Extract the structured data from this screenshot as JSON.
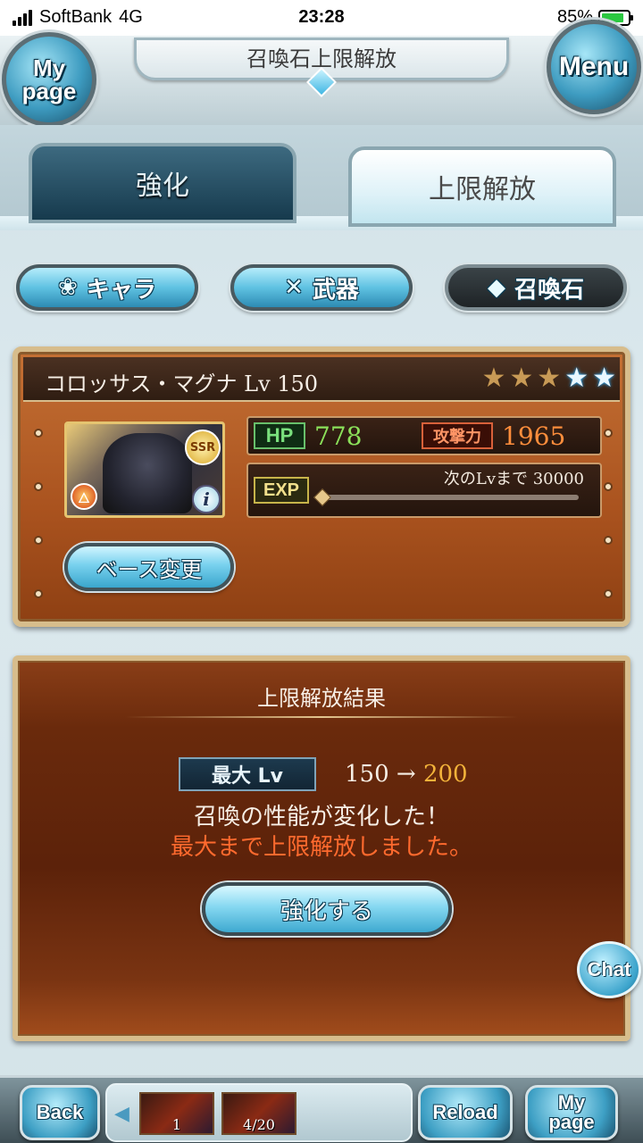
{
  "status_bar": {
    "carrier": "SoftBank",
    "network": "4G",
    "time": "23:28",
    "battery": "85%",
    "battery_level": 0.85
  },
  "header": {
    "title": "召喚石上限解放",
    "mypage_label": "My page",
    "menu_label": "Menu"
  },
  "tabs": [
    {
      "label": "強化",
      "active": false
    },
    {
      "label": "上限解放",
      "active": true
    }
  ],
  "categories": {
    "chara": "キャラ",
    "weapon": "武器",
    "summon": "召喚石",
    "selected": "召喚石"
  },
  "summon": {
    "name_level": "コロッサス・マグナ Lv 150",
    "stars_total": 5,
    "stars_gold": 3,
    "stars_blue": 2,
    "rarity": "SSR",
    "element_icon": "fire-element-icon",
    "hp_label": "HP",
    "hp": "778",
    "atk_label": "攻撃力",
    "atk": "1965",
    "exp_label": "EXP",
    "exp_next": "次のLvまで 30000",
    "exp_progress": 0.0,
    "base_change_label": "ベース変更"
  },
  "result": {
    "title": "上限解放結果",
    "maxlv_label": "最大 Lv",
    "lv_from": "150",
    "arrow": "→",
    "lv_to": "200",
    "message1": "召喚の性能が変化した！",
    "message2": "最大まで上限解放しました。",
    "enhance_button": "強化する"
  },
  "chat_label": "Chat",
  "bottom_bar": {
    "back_label": "Back",
    "reload_label": "Reload",
    "mypage_label": "My page",
    "quest1_count": "1",
    "quest2_count": "4/20"
  },
  "colors": {
    "accent_blue": "#5fc2e2",
    "panel_brown": "#a9521e",
    "hp_green": "#8be05a",
    "atk_orange": "#ff8e3c",
    "lv_new_gold": "#f2b23a",
    "warning_red": "#ff6a2e"
  }
}
